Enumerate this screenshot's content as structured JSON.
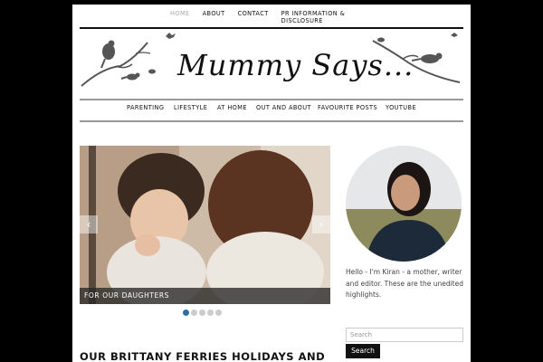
{
  "top_nav": {
    "items": [
      {
        "label": "HOME"
      },
      {
        "label": "ABOUT"
      },
      {
        "label": "CONTACT"
      },
      {
        "label": "PR INFORMATION & DISCLOSURE"
      }
    ]
  },
  "header": {
    "logo_text": "Mummy Says..."
  },
  "main_nav": {
    "items": [
      {
        "label": "PARENTING"
      },
      {
        "label": "LIFESTYLE"
      },
      {
        "label": "AT HOME"
      },
      {
        "label": "OUT AND ABOUT"
      },
      {
        "label": "FAVOURITE POSTS"
      },
      {
        "label": "YOUTUBE"
      }
    ]
  },
  "slider": {
    "caption": "FOR OUR DAUGHTERS",
    "prev_icon": "‹",
    "next_icon": "›",
    "dot_count": 5,
    "active_dot": 1
  },
  "post": {
    "title": "OUR BRITTANY FERRIES HOLIDAYS AND"
  },
  "sidebar": {
    "bio": "Hello - I'm Kiran - a mother, writer and editor. These are the unedited highlights.",
    "search_placeholder": "Search",
    "search_button": "Search"
  },
  "colors": {
    "accent": "#2d6ea8",
    "text": "#111111",
    "page_bg": "#000000"
  }
}
